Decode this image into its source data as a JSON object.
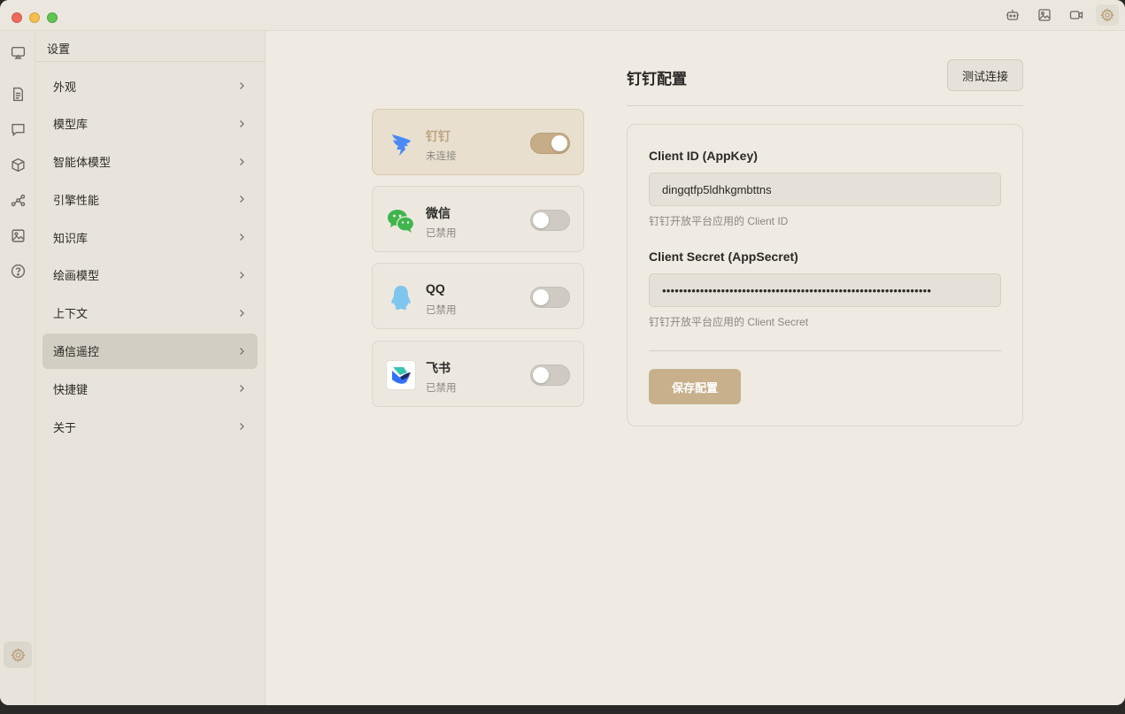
{
  "titlebar": {
    "icons": [
      "robot-icon",
      "image-icon",
      "video-icon",
      "settings-icon"
    ]
  },
  "rail": {
    "icons": [
      "screen-share-icon",
      "document-icon",
      "chat-icon",
      "cube-icon",
      "workflow-icon",
      "gallery-icon",
      "help-icon",
      "settings-icon"
    ]
  },
  "sidebar": {
    "title": "设置",
    "items": [
      {
        "label": "外观"
      },
      {
        "label": "模型库"
      },
      {
        "label": "智能体模型"
      },
      {
        "label": "引擎性能"
      },
      {
        "label": "知识库"
      },
      {
        "label": "绘画模型"
      },
      {
        "label": "上下文"
      },
      {
        "label": "通信遥控"
      },
      {
        "label": "快捷键"
      },
      {
        "label": "关于"
      }
    ],
    "active_index": 7
  },
  "channels": [
    {
      "name": "钉钉",
      "status": "未连接",
      "enabled": true,
      "icon": "dingtalk-icon"
    },
    {
      "name": "微信",
      "status": "已禁用",
      "enabled": false,
      "icon": "wechat-icon"
    },
    {
      "name": "QQ",
      "status": "已禁用",
      "enabled": false,
      "icon": "qq-icon"
    },
    {
      "name": "飞书",
      "status": "已禁用",
      "enabled": false,
      "icon": "feishu-icon"
    }
  ],
  "config": {
    "title": "钉钉配置",
    "test_button": "测试连接",
    "client_id_label": "Client ID (AppKey)",
    "client_id_value": "dingqtfp5ldhkgmbttns",
    "client_id_help": "钉钉开放平台应用的 Client ID",
    "client_secret_label": "Client Secret (AppSecret)",
    "client_secret_value": "••••••••••••••••••••••••••••••••••••••••••••••••••••••••••••••••",
    "client_secret_help": "钉钉开放平台应用的 Client Secret",
    "save_button": "保存配置"
  },
  "colors": {
    "accent": "#c9b08c",
    "background": "#efebe3",
    "sidebar": "#e8e4db",
    "active_item": "#d3cec4"
  }
}
